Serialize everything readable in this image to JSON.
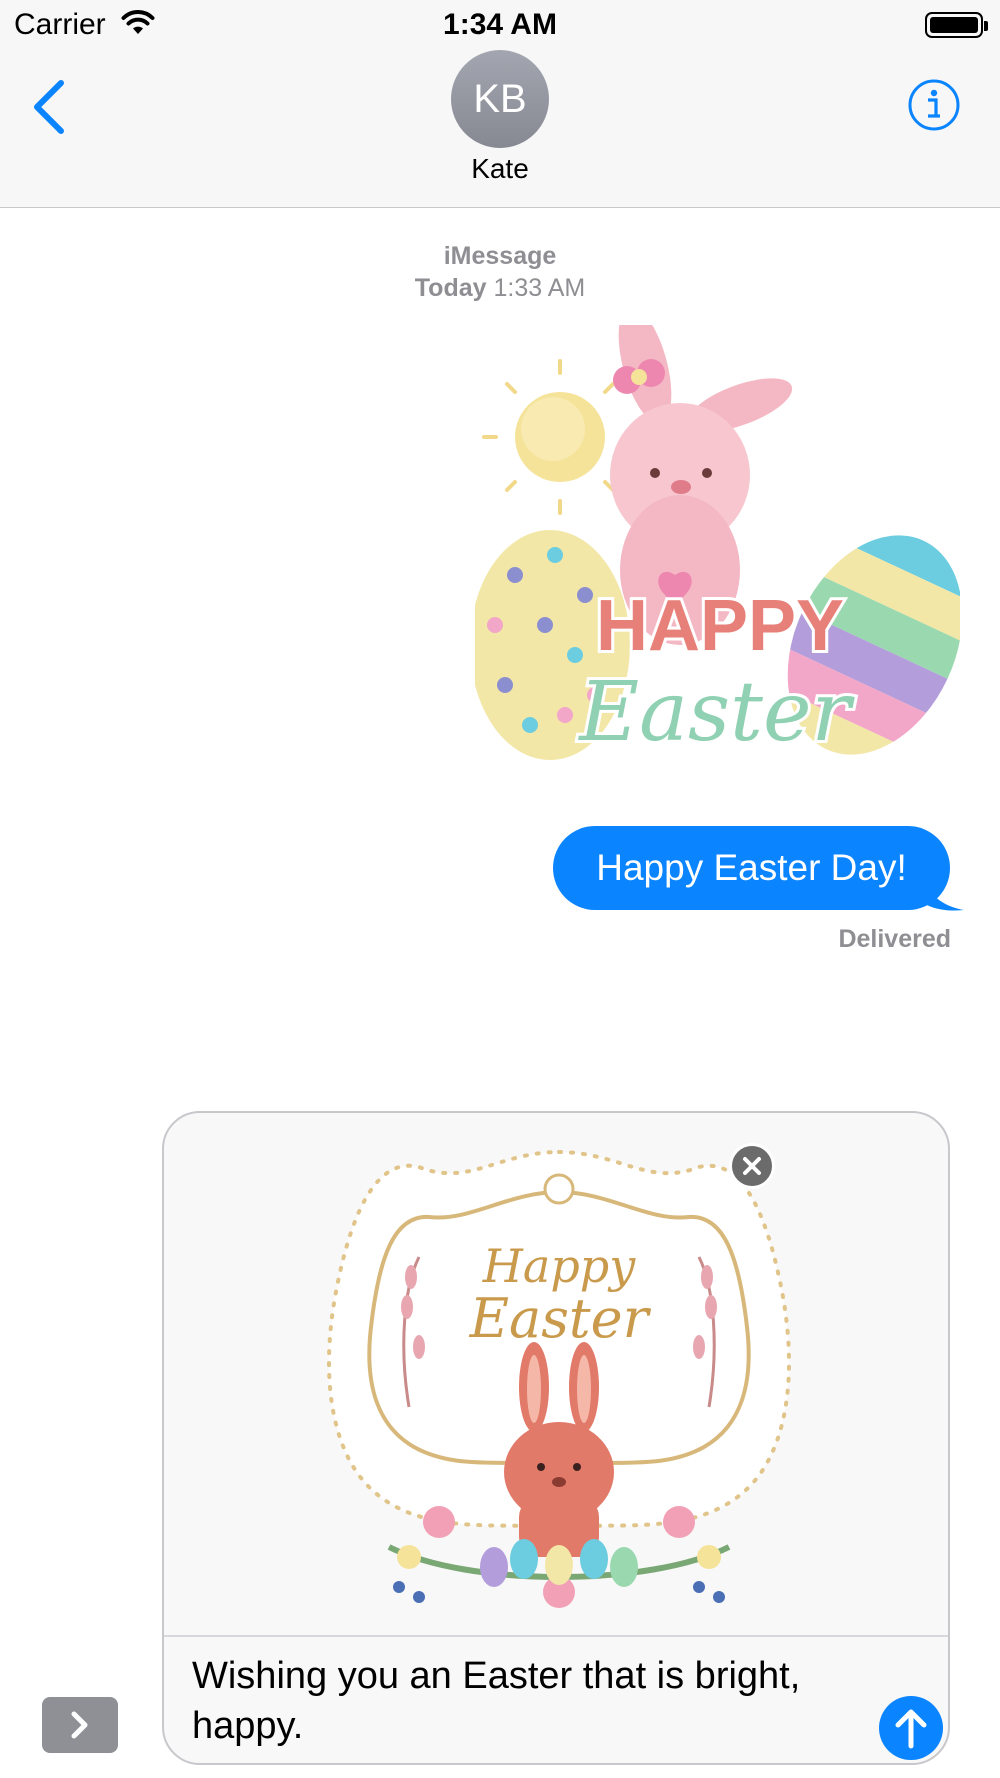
{
  "status_bar": {
    "carrier": "Carrier",
    "time": "1:34 AM"
  },
  "header": {
    "avatar_initials": "KB",
    "contact_name": "Kate"
  },
  "conversation": {
    "service": "iMessage",
    "day": "Today",
    "time": "1:33 AM",
    "sticker": {
      "line1": "HAPPY",
      "line2": "Easter"
    },
    "message": "Happy Easter Day!",
    "status": "Delivered"
  },
  "compose": {
    "sticker": {
      "line1": "Happy",
      "line2": "Easter"
    },
    "text": "Wishing you an Easter that is bright, happy."
  },
  "colors": {
    "accent": "#0a84ff",
    "bubble_text": "#ffffff",
    "meta_gray": "#8e8e93"
  },
  "icons": [
    "wifi-icon",
    "battery-icon",
    "back-chevron-icon",
    "info-icon",
    "close-icon",
    "send-arrow-icon",
    "chevron-right-icon"
  ]
}
